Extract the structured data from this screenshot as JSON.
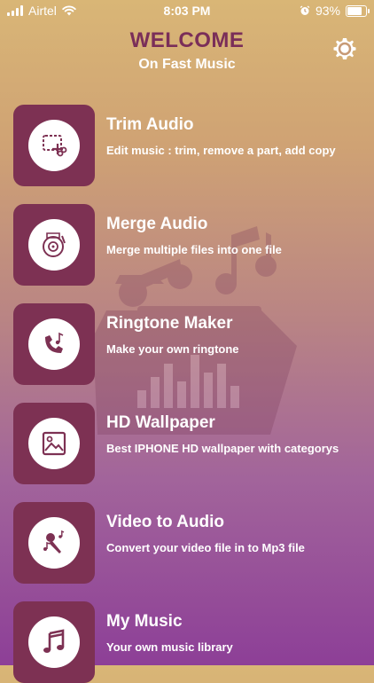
{
  "status_bar": {
    "carrier": "Airtel",
    "time": "8:03 PM",
    "battery": "93%",
    "battery_level": 0.93,
    "icons": [
      "signal-icon",
      "wifi-icon",
      "alarm-icon",
      "battery-icon"
    ]
  },
  "header": {
    "title": "WELCOME",
    "subtitle": "On Fast Music",
    "settings_icon": "gear-icon"
  },
  "colors": {
    "title": "#7a2e59",
    "tile": "#7d3153",
    "gradient_top": "#d9b676",
    "gradient_bottom": "#8d3f97"
  },
  "menu": [
    {
      "title": "Trim Audio",
      "description": "Edit music : trim, remove a part, add copy",
      "icon": "trim-icon"
    },
    {
      "title": "Merge Audio",
      "description": "Merge multiple files into one file",
      "icon": "vinyl-icon"
    },
    {
      "title": "Ringtone Maker",
      "description": "Make your own ringtone",
      "icon": "phone-music-icon"
    },
    {
      "title": "HD Wallpaper",
      "description": "Best IPHONE HD wallpaper with categorys",
      "icon": "image-icon"
    },
    {
      "title": "Video to Audio",
      "description": "Convert your video file in to Mp3 file",
      "icon": "microphone-icon"
    },
    {
      "title": "My Music",
      "description": "Your own music library",
      "icon": "music-note-icon"
    }
  ]
}
